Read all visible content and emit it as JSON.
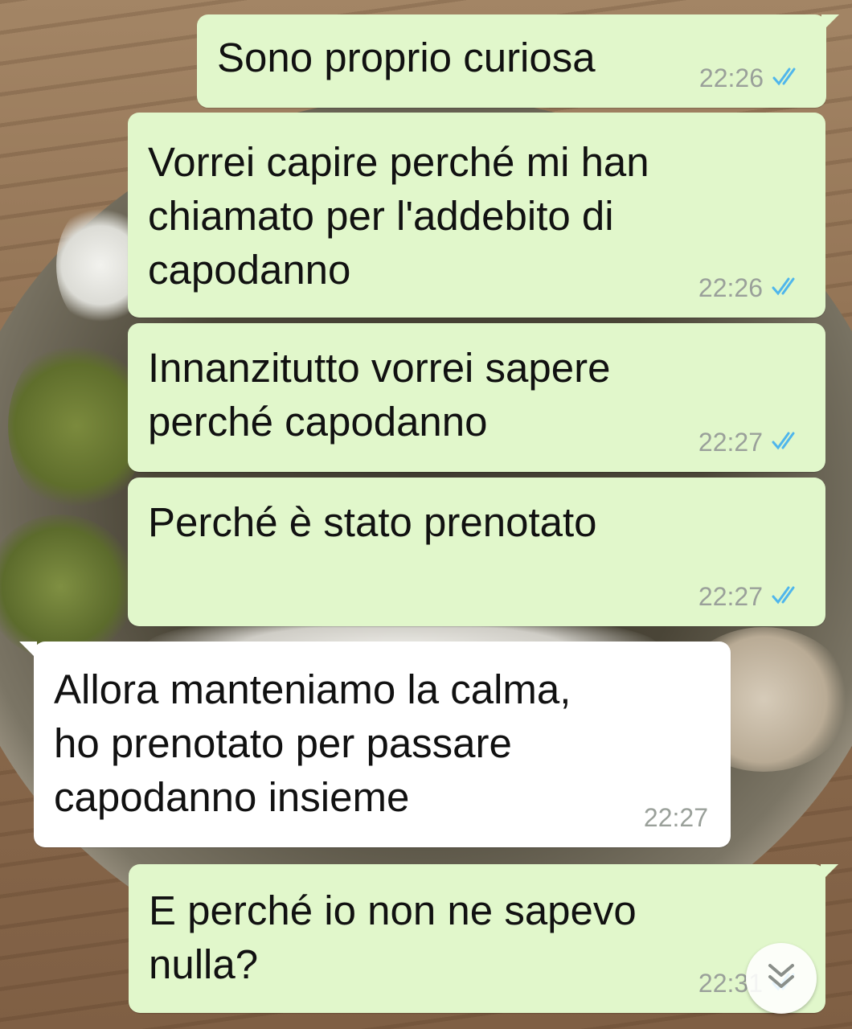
{
  "chat": {
    "messages": [
      {
        "direction": "out",
        "text": "Sono proprio curiosa",
        "time": "22:26",
        "status": "read-double-check"
      },
      {
        "direction": "out",
        "text": "Vorrei capire perché mi han\nchiamato per l'addebito di\ncapodanno",
        "time": "22:26",
        "status": "read-double-check"
      },
      {
        "direction": "out",
        "text": "Innanzitutto vorrei sapere\nperché capodanno",
        "time": "22:27",
        "status": "read-double-check"
      },
      {
        "direction": "out",
        "text": "Perché è stato prenotato",
        "time": "22:27",
        "status": "read-double-check"
      },
      {
        "direction": "in",
        "text": "Allora manteniamo la calma,\nho prenotato per passare\ncapodanno insieme",
        "time": "22:27"
      },
      {
        "direction": "out",
        "text": "E perché io non ne sapevo\nnulla?",
        "time": "22:31",
        "status": "read-double-check"
      }
    ]
  },
  "colors": {
    "outgoing_bubble": "#e1f7cb",
    "incoming_bubble": "#ffffff",
    "read_ticks": "#4fb6ec",
    "timestamp": "#9aa09a"
  },
  "icons": {
    "read_status": "double-check-icon",
    "scroll_down": "double-chevron-down-icon"
  }
}
